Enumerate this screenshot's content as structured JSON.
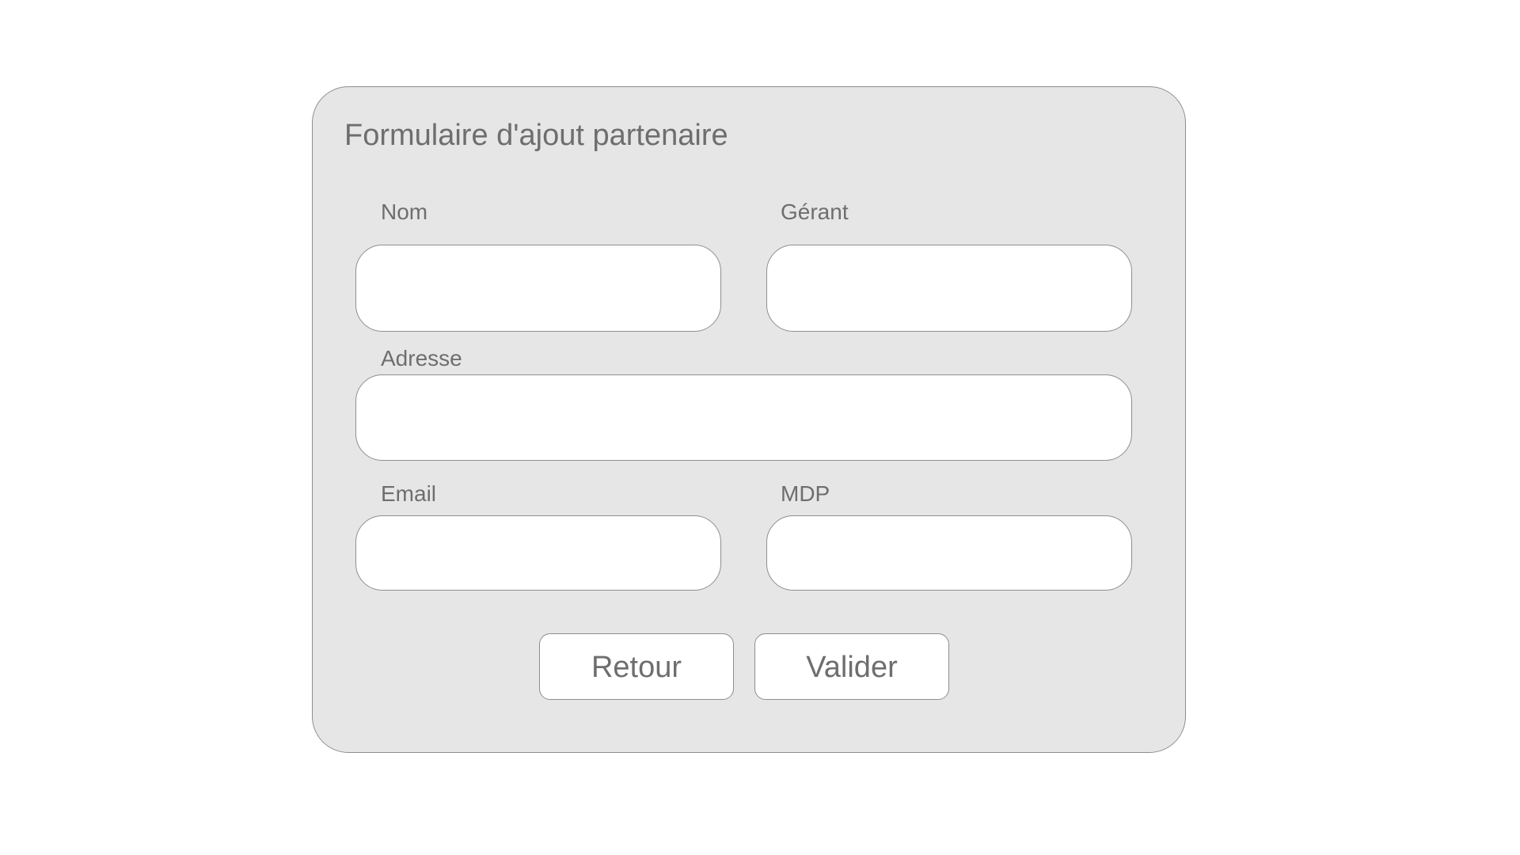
{
  "form": {
    "title": "Formulaire d'ajout partenaire",
    "fields": {
      "nom": {
        "label": "Nom",
        "value": "",
        "placeholder": ""
      },
      "gerant": {
        "label": "Gérant",
        "value": "",
        "placeholder": ""
      },
      "adresse": {
        "label": "Adresse",
        "value": "",
        "placeholder": ""
      },
      "email": {
        "label": "Email",
        "value": "",
        "placeholder": ""
      },
      "mdp": {
        "label": "MDP",
        "value": "",
        "placeholder": ""
      }
    },
    "buttons": {
      "back_label": "Retour",
      "submit_label": "Valider"
    }
  },
  "colors": {
    "page_background": "#ffffff",
    "card_background": "#e6e6e6",
    "border": "#8e8e8e",
    "text": "#6e6e6e",
    "input_background": "#ffffff"
  }
}
